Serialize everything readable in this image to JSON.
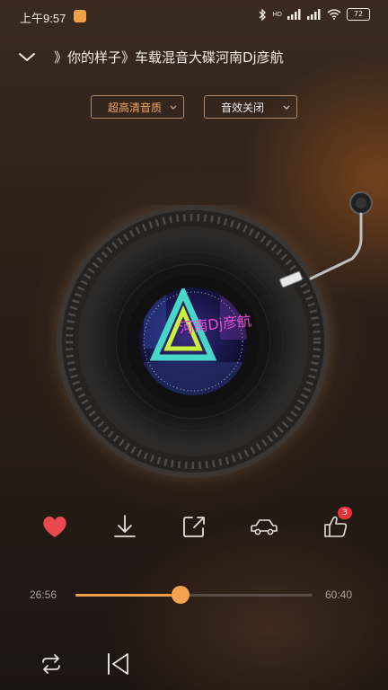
{
  "status_bar": {
    "time": "上午9:57",
    "network_label": "HD",
    "battery": "72"
  },
  "header": {
    "title": "》你的样子》车载混音大碟河南Dj彦航"
  },
  "quality_button": {
    "label": "超高清音质"
  },
  "effect_button": {
    "label": "音效关闭"
  },
  "album_art": {
    "text": "河南Dj彦航"
  },
  "actions": {
    "comment_count": "3"
  },
  "player": {
    "current_time": "26:56",
    "total_time": "60:40",
    "progress": 0.444
  },
  "colors": {
    "accent": "#f0a04a",
    "like": "#e8484f",
    "badge": "#e8353a"
  }
}
